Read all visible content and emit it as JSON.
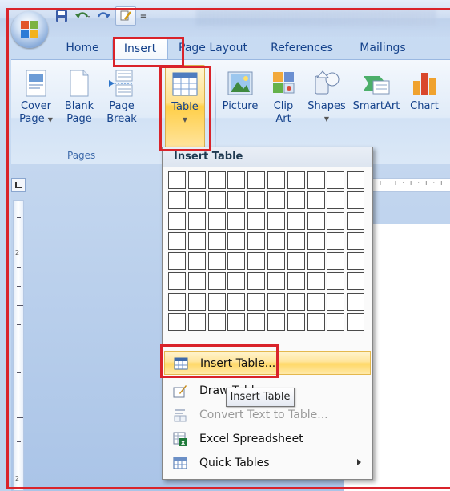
{
  "tabs": [
    {
      "label": "Home",
      "active": false
    },
    {
      "label": "Insert",
      "active": true
    },
    {
      "label": "Page Layout",
      "active": false
    },
    {
      "label": "References",
      "active": false
    },
    {
      "label": "Mailings",
      "active": false
    }
  ],
  "ribbon": {
    "pages_group": {
      "label": "Pages",
      "buttons": [
        {
          "line1": "Cover",
          "line2": "Page",
          "icon": "cover-page-icon",
          "has_dropdown": true
        },
        {
          "line1": "Blank",
          "line2": "Page",
          "icon": "blank-page-icon"
        },
        {
          "line1": "Page",
          "line2": "Break",
          "icon": "page-break-icon"
        }
      ]
    },
    "table_button": {
      "label": "Table",
      "icon": "table-icon",
      "has_dropdown": true
    },
    "illustrations": [
      {
        "line1": "Picture",
        "line2": "",
        "icon": "picture-icon"
      },
      {
        "line1": "Clip",
        "line2": "Art",
        "icon": "clip-art-icon"
      },
      {
        "line1": "Shapes",
        "line2": "",
        "icon": "shapes-icon",
        "has_dropdown": true
      },
      {
        "line1": "SmartArt",
        "line2": "",
        "icon": "smartart-icon"
      },
      {
        "line1": "Chart",
        "line2": "",
        "icon": "chart-icon"
      }
    ]
  },
  "insert_table_menu": {
    "header": "Insert Table",
    "grid": {
      "columns": 10,
      "rows": 8
    },
    "items": [
      {
        "label": "Insert Table...",
        "icon": "insert-table-icon",
        "highlighted": true,
        "enabled": true
      },
      {
        "label": "Draw Table",
        "icon": "draw-table-icon",
        "enabled": true
      },
      {
        "label": "Convert Text to Table...",
        "icon": "convert-text-icon",
        "enabled": false
      },
      {
        "label": "Excel Spreadsheet",
        "icon": "excel-spreadsheet-icon",
        "enabled": true
      },
      {
        "label": "Quick Tables",
        "icon": "quick-tables-icon",
        "enabled": true,
        "has_submenu": true
      }
    ]
  },
  "tooltip": "Insert Table",
  "colors": {
    "highlight_border": "#d9232a",
    "ribbon_text": "#15428b",
    "menu_hover": "#ffe59b"
  }
}
